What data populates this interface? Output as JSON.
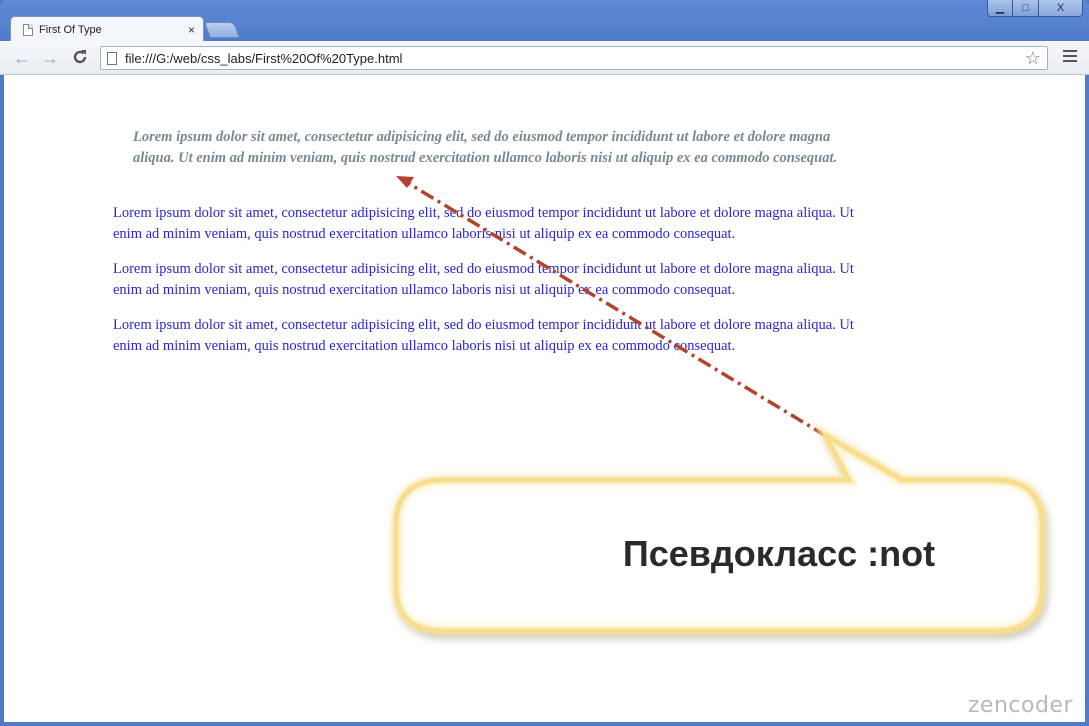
{
  "browser": {
    "tab_title": "First Of Type",
    "tab_close": "×",
    "url": "file:///G:/web/css_labs/First%20Of%20Type.html",
    "window_buttons": {
      "minimize": "▁",
      "maximize": "□",
      "close": "X"
    },
    "nav": {
      "back": "←",
      "forward": "→",
      "reload": "C"
    },
    "star": "☆"
  },
  "page": {
    "paragraphs": [
      "Lorem ipsum dolor sit amet, consectetur adipisicing elit, sed do eiusmod tempor incididunt ut labore et dolore magna aliqua. Ut enim ad minim veniam, quis nostrud exercitation ullamco laboris nisi ut aliquip ex ea commodo consequat.",
      "Lorem ipsum dolor sit amet, consectetur adipisicing elit, sed do eiusmod tempor incididunt ut labore et dolore magna aliqua. Ut enim ad minim veniam, quis nostrud exercitation ullamco laboris nisi ut aliquip ex ea commodo consequat.",
      "Lorem ipsum dolor sit amet, consectetur adipisicing elit, sed do eiusmod tempor incididunt ut labore et dolore magna aliqua. Ut enim ad minim veniam, quis nostrud exercitation ullamco laboris nisi ut aliquip ex ea commodo consequat.",
      "Lorem ipsum dolor sit amet, consectetur adipisicing elit, sed do eiusmod tempor incididunt ut labore et dolore magna aliqua. Ut enim ad minim veniam, quis nostrud exercitation ullamco laboris nisi ut aliquip ex ea commodo consequat."
    ]
  },
  "annotation": {
    "callout_text": "Псевдокласс :not",
    "arrow_color": "#b5422b",
    "callout_border_color": "#f3d26a"
  },
  "watermark": "zencoder",
  "colors": {
    "first_paragraph": "#7a8794",
    "other_paragraphs": "#2a25d6",
    "window_frame": "#4f7bcb"
  }
}
